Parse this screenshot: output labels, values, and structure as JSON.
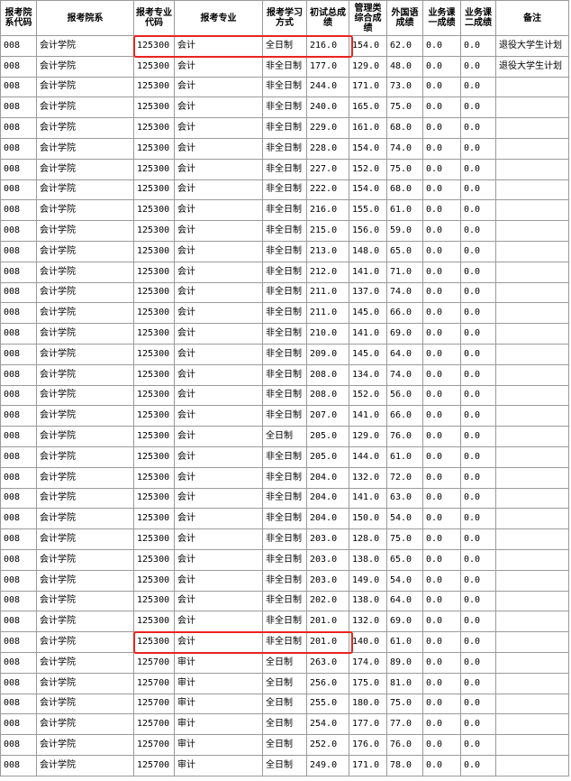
{
  "columns": [
    "报考院系代码",
    "报考院系",
    "报考专业代码",
    "报考专业",
    "报考学习方式",
    "初试总成绩",
    "管理类综合成绩",
    "外国语成绩",
    "业务课一成绩",
    "业务课二成绩",
    "备注"
  ],
  "rows": [
    [
      "008",
      "会计学院",
      "125300",
      "会计",
      "全日制",
      "216.0",
      "154.0",
      "62.0",
      "0.0",
      "0.0",
      "退役大学生计划"
    ],
    [
      "008",
      "会计学院",
      "125300",
      "会计",
      "非全日制",
      "177.0",
      "129.0",
      "48.0",
      "0.0",
      "0.0",
      "退役大学生计划"
    ],
    [
      "008",
      "会计学院",
      "125300",
      "会计",
      "非全日制",
      "244.0",
      "171.0",
      "73.0",
      "0.0",
      "0.0",
      ""
    ],
    [
      "008",
      "会计学院",
      "125300",
      "会计",
      "非全日制",
      "240.0",
      "165.0",
      "75.0",
      "0.0",
      "0.0",
      ""
    ],
    [
      "008",
      "会计学院",
      "125300",
      "会计",
      "非全日制",
      "229.0",
      "161.0",
      "68.0",
      "0.0",
      "0.0",
      ""
    ],
    [
      "008",
      "会计学院",
      "125300",
      "会计",
      "非全日制",
      "228.0",
      "154.0",
      "74.0",
      "0.0",
      "0.0",
      ""
    ],
    [
      "008",
      "会计学院",
      "125300",
      "会计",
      "非全日制",
      "227.0",
      "152.0",
      "75.0",
      "0.0",
      "0.0",
      ""
    ],
    [
      "008",
      "会计学院",
      "125300",
      "会计",
      "非全日制",
      "222.0",
      "154.0",
      "68.0",
      "0.0",
      "0.0",
      ""
    ],
    [
      "008",
      "会计学院",
      "125300",
      "会计",
      "非全日制",
      "216.0",
      "155.0",
      "61.0",
      "0.0",
      "0.0",
      ""
    ],
    [
      "008",
      "会计学院",
      "125300",
      "会计",
      "非全日制",
      "215.0",
      "156.0",
      "59.0",
      "0.0",
      "0.0",
      ""
    ],
    [
      "008",
      "会计学院",
      "125300",
      "会计",
      "非全日制",
      "213.0",
      "148.0",
      "65.0",
      "0.0",
      "0.0",
      ""
    ],
    [
      "008",
      "会计学院",
      "125300",
      "会计",
      "非全日制",
      "212.0",
      "141.0",
      "71.0",
      "0.0",
      "0.0",
      ""
    ],
    [
      "008",
      "会计学院",
      "125300",
      "会计",
      "非全日制",
      "211.0",
      "137.0",
      "74.0",
      "0.0",
      "0.0",
      ""
    ],
    [
      "008",
      "会计学院",
      "125300",
      "会计",
      "非全日制",
      "211.0",
      "145.0",
      "66.0",
      "0.0",
      "0.0",
      ""
    ],
    [
      "008",
      "会计学院",
      "125300",
      "会计",
      "非全日制",
      "210.0",
      "141.0",
      "69.0",
      "0.0",
      "0.0",
      ""
    ],
    [
      "008",
      "会计学院",
      "125300",
      "会计",
      "非全日制",
      "209.0",
      "145.0",
      "64.0",
      "0.0",
      "0.0",
      ""
    ],
    [
      "008",
      "会计学院",
      "125300",
      "会计",
      "非全日制",
      "208.0",
      "134.0",
      "74.0",
      "0.0",
      "0.0",
      ""
    ],
    [
      "008",
      "会计学院",
      "125300",
      "会计",
      "非全日制",
      "208.0",
      "152.0",
      "56.0",
      "0.0",
      "0.0",
      ""
    ],
    [
      "008",
      "会计学院",
      "125300",
      "会计",
      "非全日制",
      "207.0",
      "141.0",
      "66.0",
      "0.0",
      "0.0",
      ""
    ],
    [
      "008",
      "会计学院",
      "125300",
      "会计",
      "全日制",
      "205.0",
      "129.0",
      "76.0",
      "0.0",
      "0.0",
      ""
    ],
    [
      "008",
      "会计学院",
      "125300",
      "会计",
      "非全日制",
      "205.0",
      "144.0",
      "61.0",
      "0.0",
      "0.0",
      ""
    ],
    [
      "008",
      "会计学院",
      "125300",
      "会计",
      "非全日制",
      "204.0",
      "132.0",
      "72.0",
      "0.0",
      "0.0",
      ""
    ],
    [
      "008",
      "会计学院",
      "125300",
      "会计",
      "非全日制",
      "204.0",
      "141.0",
      "63.0",
      "0.0",
      "0.0",
      ""
    ],
    [
      "008",
      "会计学院",
      "125300",
      "会计",
      "非全日制",
      "204.0",
      "150.0",
      "54.0",
      "0.0",
      "0.0",
      ""
    ],
    [
      "008",
      "会计学院",
      "125300",
      "会计",
      "非全日制",
      "203.0",
      "128.0",
      "75.0",
      "0.0",
      "0.0",
      ""
    ],
    [
      "008",
      "会计学院",
      "125300",
      "会计",
      "非全日制",
      "203.0",
      "138.0",
      "65.0",
      "0.0",
      "0.0",
      ""
    ],
    [
      "008",
      "会计学院",
      "125300",
      "会计",
      "非全日制",
      "203.0",
      "149.0",
      "54.0",
      "0.0",
      "0.0",
      ""
    ],
    [
      "008",
      "会计学院",
      "125300",
      "会计",
      "非全日制",
      "202.0",
      "138.0",
      "64.0",
      "0.0",
      "0.0",
      ""
    ],
    [
      "008",
      "会计学院",
      "125300",
      "会计",
      "非全日制",
      "201.0",
      "132.0",
      "69.0",
      "0.0",
      "0.0",
      ""
    ],
    [
      "008",
      "会计学院",
      "125300",
      "会计",
      "非全日制",
      "201.0",
      "140.0",
      "61.0",
      "0.0",
      "0.0",
      ""
    ],
    [
      "008",
      "会计学院",
      "125700",
      "审计",
      "全日制",
      "263.0",
      "174.0",
      "89.0",
      "0.0",
      "0.0",
      ""
    ],
    [
      "008",
      "会计学院",
      "125700",
      "审计",
      "全日制",
      "256.0",
      "175.0",
      "81.0",
      "0.0",
      "0.0",
      ""
    ],
    [
      "008",
      "会计学院",
      "125700",
      "审计",
      "全日制",
      "255.0",
      "180.0",
      "75.0",
      "0.0",
      "0.0",
      ""
    ],
    [
      "008",
      "会计学院",
      "125700",
      "审计",
      "全日制",
      "254.0",
      "177.0",
      "77.0",
      "0.0",
      "0.0",
      ""
    ],
    [
      "008",
      "会计学院",
      "125700",
      "审计",
      "全日制",
      "252.0",
      "176.0",
      "76.0",
      "0.0",
      "0.0",
      ""
    ],
    [
      "008",
      "会计学院",
      "125700",
      "审计",
      "全日制",
      "249.0",
      "171.0",
      "78.0",
      "0.0",
      "0.0",
      ""
    ]
  ],
  "highlight_color": "#e8241f",
  "highlighted_rows": [
    0,
    29
  ]
}
